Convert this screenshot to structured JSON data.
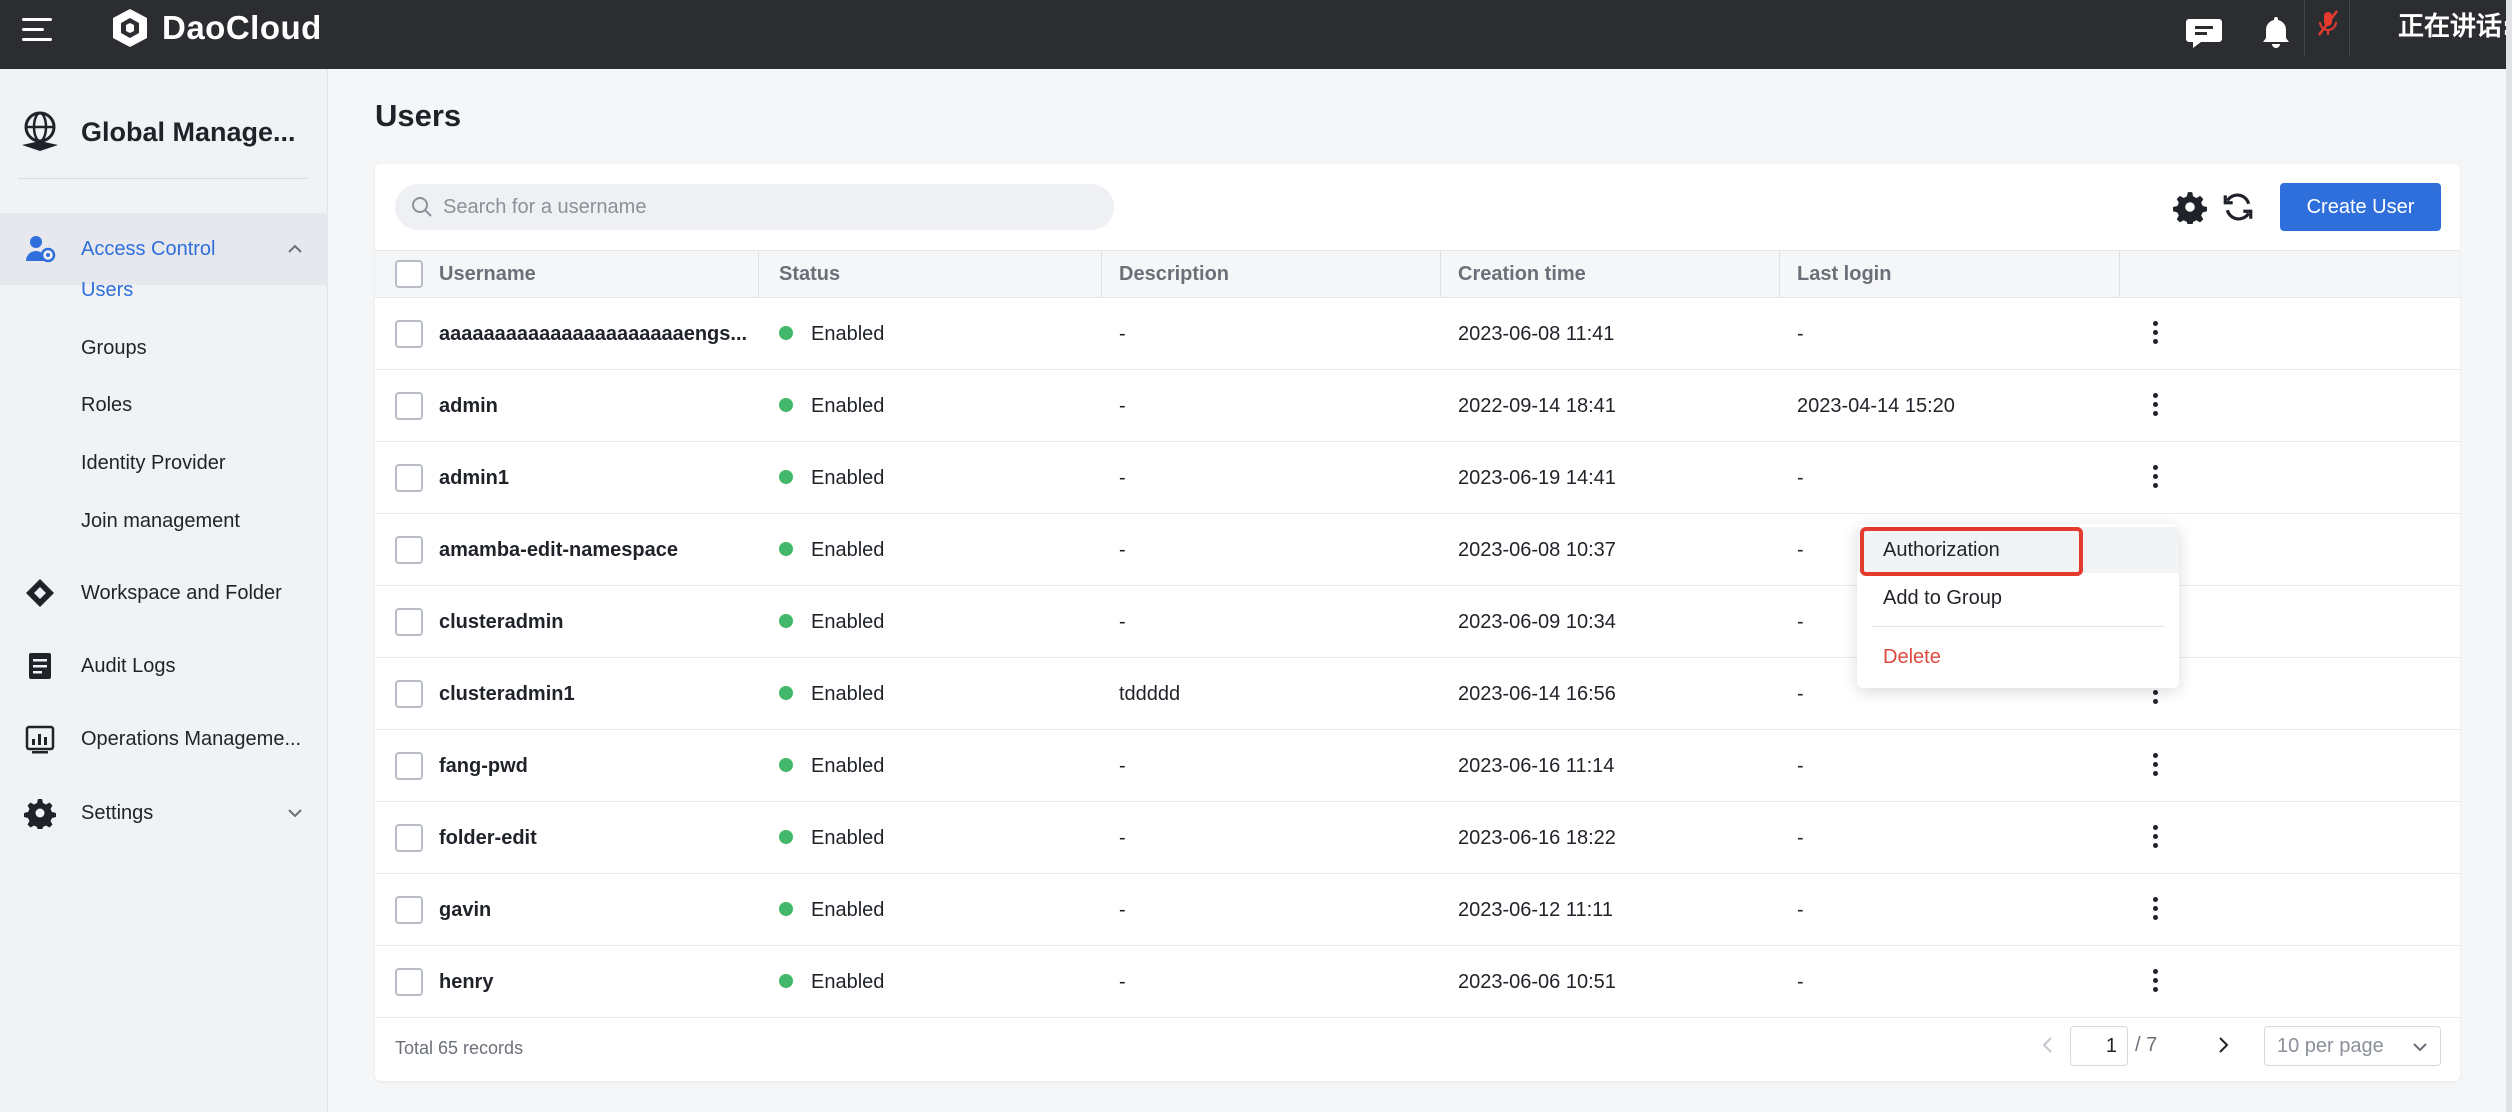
{
  "topbar": {
    "brand": "DaoCloud",
    "status_text": "正在讲话:"
  },
  "sidebar": {
    "product_name": "Global Manage...",
    "groups": [
      {
        "label": "Access Control",
        "expanded": true
      },
      {
        "label": "Workspace and Folder"
      },
      {
        "label": "Audit Logs"
      },
      {
        "label": "Operations Manageme..."
      },
      {
        "label": "Settings",
        "expanded": false
      }
    ],
    "access_control_items": [
      "Users",
      "Groups",
      "Roles",
      "Identity Provider",
      "Join management"
    ],
    "active_item": "Users"
  },
  "page": {
    "title": "Users",
    "search_placeholder": "Search for a username",
    "create_button": "Create User"
  },
  "table": {
    "columns": [
      "Username",
      "Status",
      "Description",
      "Creation time",
      "Last login"
    ],
    "rows": [
      {
        "username": "aaaaaaaaaaaaaaaaaaaaaaengs...",
        "status": "Enabled",
        "description": "-",
        "created": "2023-06-08 11:41",
        "last_login": "-"
      },
      {
        "username": "admin",
        "status": "Enabled",
        "description": "-",
        "created": "2022-09-14 18:41",
        "last_login": "2023-04-14 15:20"
      },
      {
        "username": "admin1",
        "status": "Enabled",
        "description": "-",
        "created": "2023-06-19 14:41",
        "last_login": "-"
      },
      {
        "username": "amamba-edit-namespace",
        "status": "Enabled",
        "description": "-",
        "created": "2023-06-08 10:37",
        "last_login": "-"
      },
      {
        "username": "clusteradmin",
        "status": "Enabled",
        "description": "-",
        "created": "2023-06-09 10:34",
        "last_login": "-"
      },
      {
        "username": "clusteradmin1",
        "status": "Enabled",
        "description": "tddddd",
        "created": "2023-06-14 16:56",
        "last_login": "-"
      },
      {
        "username": "fang-pwd",
        "status": "Enabled",
        "description": "-",
        "created": "2023-06-16 11:14",
        "last_login": "-"
      },
      {
        "username": "folder-edit",
        "status": "Enabled",
        "description": "-",
        "created": "2023-06-16 18:22",
        "last_login": "-"
      },
      {
        "username": "gavin",
        "status": "Enabled",
        "description": "-",
        "created": "2023-06-12 11:11",
        "last_login": "-"
      },
      {
        "username": "henry",
        "status": "Enabled",
        "description": "-",
        "created": "2023-06-06 10:51",
        "last_login": "-"
      }
    ]
  },
  "pagination": {
    "total": "Total 65 records",
    "current_page": "1",
    "total_pages": "/ 7",
    "per_page": "10 per page"
  },
  "context_menu": {
    "items": [
      "Authorization",
      "Add to Group",
      "Delete"
    ],
    "highlighted": "Authorization"
  },
  "colors": {
    "accent": "#2f6fdb",
    "topbar": "#2b2d31",
    "enabled_dot": "#43b76a",
    "danger": "#e0493f",
    "highlight_box": "#e53b2f"
  }
}
